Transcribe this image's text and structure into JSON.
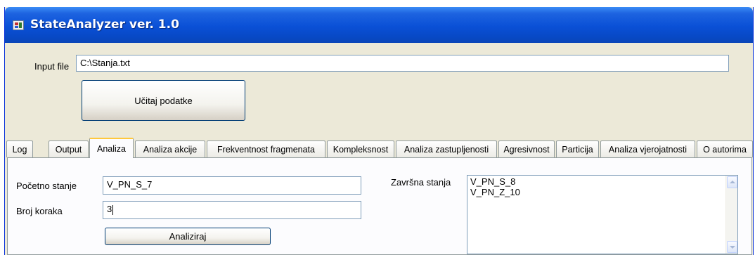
{
  "window": {
    "title": "StateAnalyzer ver. 1.0",
    "icon": "app-icon"
  },
  "input": {
    "label": "Input file",
    "value": "C:\\Stanja.txt",
    "load_button": "Učitaj podatke"
  },
  "tabs": [
    {
      "label": "Log"
    },
    {
      "label": "Output"
    },
    {
      "label": "Analiza",
      "selected": true
    },
    {
      "label": "Analiza akcije"
    },
    {
      "label": "Frekventnost fragmenata"
    },
    {
      "label": "Kompleksnost"
    },
    {
      "label": "Analiza zastupljenosti"
    },
    {
      "label": "Agresivnost"
    },
    {
      "label": "Particija"
    },
    {
      "label": "Analiza vjerojatnosti"
    },
    {
      "label": "O autorima"
    }
  ],
  "analiza": {
    "start_state_label": "Početno stanje",
    "start_state_value": "V_PN_S_7",
    "steps_label": "Broj koraka",
    "steps_value": "3",
    "analyze_button": "Analiziraj",
    "final_states_label": "Završna stanja",
    "final_states": [
      "V_PN_S_8",
      "V_PN_Z_10"
    ]
  }
}
